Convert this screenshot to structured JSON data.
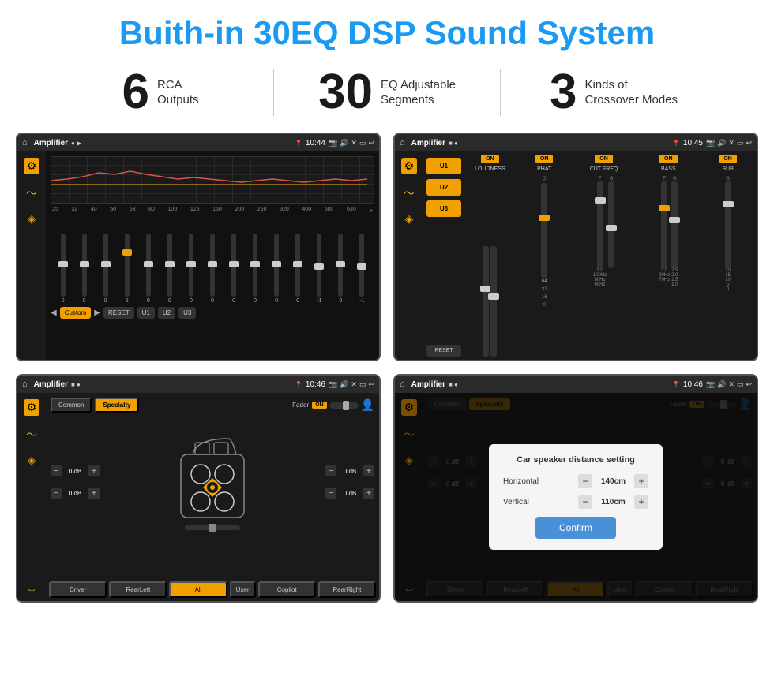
{
  "header": {
    "title": "Buith-in 30EQ DSP Sound System"
  },
  "stats": [
    {
      "number": "6",
      "label_line1": "RCA",
      "label_line2": "Outputs"
    },
    {
      "number": "30",
      "label_line1": "EQ Adjustable",
      "label_line2": "Segments"
    },
    {
      "number": "3",
      "label_line1": "Kinds of",
      "label_line2": "Crossover Modes"
    }
  ],
  "screens": {
    "screen1": {
      "topbar": {
        "title": "Amplifier",
        "time": "10:44"
      },
      "eq_freqs": [
        "25",
        "32",
        "40",
        "50",
        "63",
        "80",
        "100",
        "125",
        "160",
        "200",
        "250",
        "320",
        "400",
        "500",
        "630"
      ],
      "eq_values": [
        "0",
        "0",
        "0",
        "5",
        "0",
        "0",
        "0",
        "0",
        "0",
        "0",
        "0",
        "0",
        "-1",
        "0",
        "-1"
      ],
      "buttons": [
        "Custom",
        "RESET",
        "U1",
        "U2",
        "U3"
      ]
    },
    "screen2": {
      "topbar": {
        "title": "Amplifier",
        "time": "10:45"
      },
      "u_buttons": [
        "U1",
        "U2",
        "U3"
      ],
      "controls": [
        {
          "label": "LOUDNESS",
          "on": true
        },
        {
          "label": "PHAT",
          "on": true
        },
        {
          "label": "CUT FREQ",
          "on": true
        },
        {
          "label": "BASS",
          "on": true
        },
        {
          "label": "SUB",
          "on": true
        }
      ],
      "reset": "RESET"
    },
    "screen3": {
      "topbar": {
        "title": "Amplifier",
        "time": "10:46"
      },
      "tabs": [
        "Common",
        "Specialty"
      ],
      "fader": {
        "label": "Fader",
        "on": "ON"
      },
      "db_values": [
        "0 dB",
        "0 dB",
        "0 dB",
        "0 dB"
      ],
      "bottom_buttons": [
        "Driver",
        "RearLeft",
        "All",
        "User",
        "Copilot",
        "RearRight"
      ]
    },
    "screen4": {
      "topbar": {
        "title": "Amplifier",
        "time": "10:46"
      },
      "tabs": [
        "Common",
        "Specialty"
      ],
      "dialog": {
        "title": "Car speaker distance setting",
        "horizontal_label": "Horizontal",
        "horizontal_value": "140cm",
        "vertical_label": "Vertical",
        "vertical_value": "110cm",
        "confirm_label": "Confirm"
      },
      "db_values": [
        "0 dB",
        "0 dB"
      ],
      "bottom_buttons": [
        "Driver",
        "RearLeft",
        "All",
        "User",
        "Copilot",
        "RearRight"
      ]
    }
  }
}
